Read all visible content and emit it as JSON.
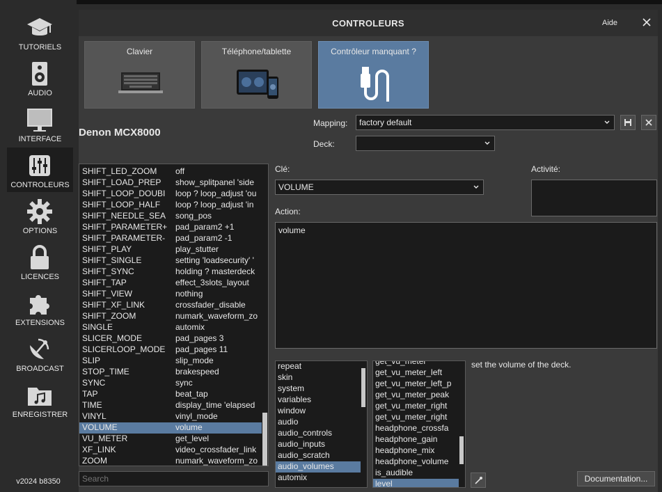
{
  "sidebar": {
    "items": [
      {
        "label": "TUTORIELS",
        "icon": "graduation-cap-icon"
      },
      {
        "label": "AUDIO",
        "icon": "speaker-icon"
      },
      {
        "label": "INTERFACE",
        "icon": "monitor-icon"
      },
      {
        "label": "CONTROLEURS",
        "icon": "sliders-icon",
        "active": true
      },
      {
        "label": "OPTIONS",
        "icon": "gear-icon"
      },
      {
        "label": "LICENCES",
        "icon": "lock-icon"
      },
      {
        "label": "EXTENSIONS",
        "icon": "puzzle-icon"
      },
      {
        "label": "BROADCAST",
        "icon": "satellite-dish-icon"
      },
      {
        "label": "ENREGISTRER",
        "icon": "music-folder-icon"
      }
    ],
    "version": "v2024 b8350"
  },
  "header": {
    "title": "CONTROLEURS",
    "help_label": "Aide"
  },
  "tiles": [
    {
      "label": "Clavier",
      "icon": "keyboard-icon"
    },
    {
      "label": "Téléphone/tablette",
      "icon": "tablet-phone-icon"
    },
    {
      "label": "Contrôleur manquant ?",
      "icon": "usb-cable-icon",
      "selected": true
    }
  ],
  "device_name": "Denon MCX8000",
  "mapping": {
    "label": "Mapping:",
    "value": "factory default"
  },
  "deck": {
    "label": "Deck:",
    "value": ""
  },
  "key_list": {
    "rows": [
      {
        "key": "SHIFT_LED_ZOOM",
        "value": "off"
      },
      {
        "key": "SHIFT_LOAD_PREP",
        "value": "show_splitpanel 'side"
      },
      {
        "key": "SHIFT_LOOP_DOUBI",
        "value": "loop ? loop_adjust 'ou"
      },
      {
        "key": "SHIFT_LOOP_HALF",
        "value": "loop ? loop_adjust 'in"
      },
      {
        "key": "SHIFT_NEEDLE_SEA",
        "value": "song_pos"
      },
      {
        "key": "SHIFT_PARAMETER+",
        "value": "pad_param2 +1"
      },
      {
        "key": "SHIFT_PARAMETER-",
        "value": "pad_param2 -1"
      },
      {
        "key": "SHIFT_PLAY",
        "value": "play_stutter"
      },
      {
        "key": "SHIFT_SINGLE",
        "value": "setting 'loadsecurity' '"
      },
      {
        "key": "SHIFT_SYNC",
        "value": "holding ? masterdeck"
      },
      {
        "key": "SHIFT_TAP",
        "value": "effect_3slots_layout"
      },
      {
        "key": "SHIFT_VIEW",
        "value": "nothing"
      },
      {
        "key": "SHIFT_XF_LINK",
        "value": "crossfader_disable"
      },
      {
        "key": "SHIFT_ZOOM",
        "value": "numark_waveform_zo"
      },
      {
        "key": "SINGLE",
        "value": "automix"
      },
      {
        "key": "SLICER_MODE",
        "value": "pad_pages 3"
      },
      {
        "key": "SLICERLOOP_MODE",
        "value": "pad_pages 11"
      },
      {
        "key": "SLIP",
        "value": "slip_mode"
      },
      {
        "key": "STOP_TIME",
        "value": "brakespeed"
      },
      {
        "key": "SYNC",
        "value": "sync"
      },
      {
        "key": "TAP",
        "value": "beat_tap"
      },
      {
        "key": "TIME",
        "value": "display_time 'elapsed"
      },
      {
        "key": "VINYL",
        "value": "vinyl_mode"
      },
      {
        "key": "VOLUME",
        "value": "volume",
        "selected": true
      },
      {
        "key": "VU_METER",
        "value": "get_level"
      },
      {
        "key": "XF_LINK",
        "value": "video_crossfader_link"
      },
      {
        "key": "ZOOM",
        "value": "numark_waveform_zo"
      }
    ]
  },
  "search": {
    "placeholder": "Search"
  },
  "key_field": {
    "label": "Clé:",
    "value": "VOLUME"
  },
  "activity": {
    "label": "Activité:"
  },
  "action": {
    "label": "Action:",
    "value": "volume"
  },
  "categories": {
    "items": [
      "repeat",
      "skin",
      "system",
      "variables",
      "window",
      "audio",
      "audio_controls",
      "audio_inputs",
      "audio_scratch",
      "audio_volumes",
      "automix"
    ],
    "selected": "audio_volumes"
  },
  "verbs": {
    "items": [
      "get_vu_meter",
      "get_vu_meter_left",
      "get_vu_meter_left_p",
      "get_vu_meter_peak",
      "get_vu_meter_right",
      "get_vu_meter_right",
      "headphone_crossfa",
      "headphone_gain",
      "headphone_mix",
      "headphone_volume",
      "is_audible",
      "level"
    ],
    "selected": "level"
  },
  "description": "set the volume of the deck.",
  "documentation_label": "Documentation...",
  "colors": {
    "accent": "#5a7ba0",
    "panel": "#3a3a3a",
    "field": "#1b1b1b"
  }
}
